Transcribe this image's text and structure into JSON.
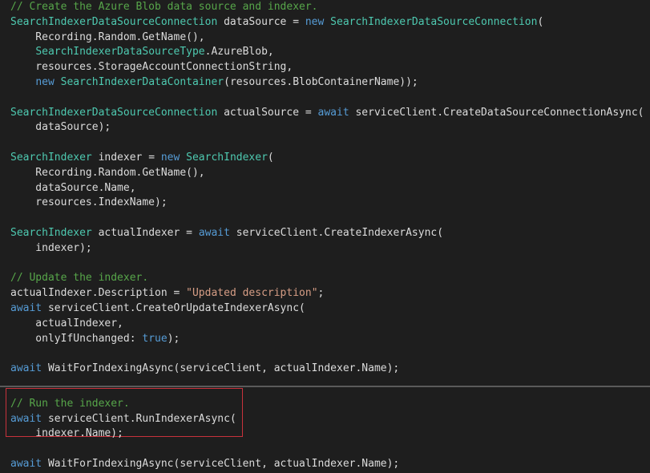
{
  "colors": {
    "background": "#1e1e1e",
    "plain": "#dcdcdc",
    "type": "#4ec9b0",
    "keyword": "#569cd6",
    "comment": "#57a64a",
    "string": "#d69d85",
    "highlight_border": "#c8323c"
  },
  "code": {
    "lines": [
      [
        {
          "k": "c",
          "v": "// Create the Azure Blob data source and indexer."
        }
      ],
      [
        {
          "k": "t",
          "v": "SearchIndexerDataSourceConnection"
        },
        {
          "k": "p",
          "v": " dataSource = "
        },
        {
          "k": "k",
          "v": "new"
        },
        {
          "k": "p",
          "v": " "
        },
        {
          "k": "t",
          "v": "SearchIndexerDataSourceConnection"
        },
        {
          "k": "p",
          "v": "("
        }
      ],
      [
        {
          "k": "p",
          "v": "    Recording.Random.GetName(),"
        }
      ],
      [
        {
          "k": "p",
          "v": "    "
        },
        {
          "k": "t",
          "v": "SearchIndexerDataSourceType"
        },
        {
          "k": "p",
          "v": ".AzureBlob,"
        }
      ],
      [
        {
          "k": "p",
          "v": "    resources.StorageAccountConnectionString,"
        }
      ],
      [
        {
          "k": "p",
          "v": "    "
        },
        {
          "k": "k",
          "v": "new"
        },
        {
          "k": "p",
          "v": " "
        },
        {
          "k": "t",
          "v": "SearchIndexerDataContainer"
        },
        {
          "k": "p",
          "v": "(resources.BlobContainerName));"
        }
      ],
      [],
      [
        {
          "k": "t",
          "v": "SearchIndexerDataSourceConnection"
        },
        {
          "k": "p",
          "v": " actualSource = "
        },
        {
          "k": "k",
          "v": "await"
        },
        {
          "k": "p",
          "v": " serviceClient.CreateDataSourceConnectionAsync("
        }
      ],
      [
        {
          "k": "p",
          "v": "    dataSource);"
        }
      ],
      [],
      [
        {
          "k": "t",
          "v": "SearchIndexer"
        },
        {
          "k": "p",
          "v": " indexer = "
        },
        {
          "k": "k",
          "v": "new"
        },
        {
          "k": "p",
          "v": " "
        },
        {
          "k": "t",
          "v": "SearchIndexer"
        },
        {
          "k": "p",
          "v": "("
        }
      ],
      [
        {
          "k": "p",
          "v": "    Recording.Random.GetName(),"
        }
      ],
      [
        {
          "k": "p",
          "v": "    dataSource.Name,"
        }
      ],
      [
        {
          "k": "p",
          "v": "    resources.IndexName);"
        }
      ],
      [],
      [
        {
          "k": "t",
          "v": "SearchIndexer"
        },
        {
          "k": "p",
          "v": " actualIndexer = "
        },
        {
          "k": "k",
          "v": "await"
        },
        {
          "k": "p",
          "v": " serviceClient.CreateIndexerAsync("
        }
      ],
      [
        {
          "k": "p",
          "v": "    indexer);"
        }
      ],
      [],
      [
        {
          "k": "c",
          "v": "// Update the indexer."
        }
      ],
      [
        {
          "k": "p",
          "v": "actualIndexer.Description = "
        },
        {
          "k": "s",
          "v": "\"Updated description\""
        },
        {
          "k": "p",
          "v": ";"
        }
      ],
      [
        {
          "k": "k",
          "v": "await"
        },
        {
          "k": "p",
          "v": " serviceClient.CreateOrUpdateIndexerAsync("
        }
      ],
      [
        {
          "k": "p",
          "v": "    actualIndexer,"
        }
      ],
      [
        {
          "k": "p",
          "v": "    onlyIfUnchanged: "
        },
        {
          "k": "k",
          "v": "true"
        },
        {
          "k": "p",
          "v": ");"
        }
      ],
      [],
      [
        {
          "k": "k",
          "v": "await"
        },
        {
          "k": "p",
          "v": " WaitForIndexingAsync(serviceClient, actualIndexer.Name);"
        }
      ],
      [],
      [
        {
          "k": "c",
          "v": "// Run the indexer."
        }
      ],
      [
        {
          "k": "k",
          "v": "await"
        },
        {
          "k": "p",
          "v": " serviceClient.RunIndexerAsync("
        }
      ],
      [
        {
          "k": "p",
          "v": "    indexer.Name);"
        }
      ],
      [],
      [
        {
          "k": "k",
          "v": "await"
        },
        {
          "k": "p",
          "v": " WaitForIndexingAsync(serviceClient, actualIndexer.Name);"
        }
      ]
    ]
  }
}
